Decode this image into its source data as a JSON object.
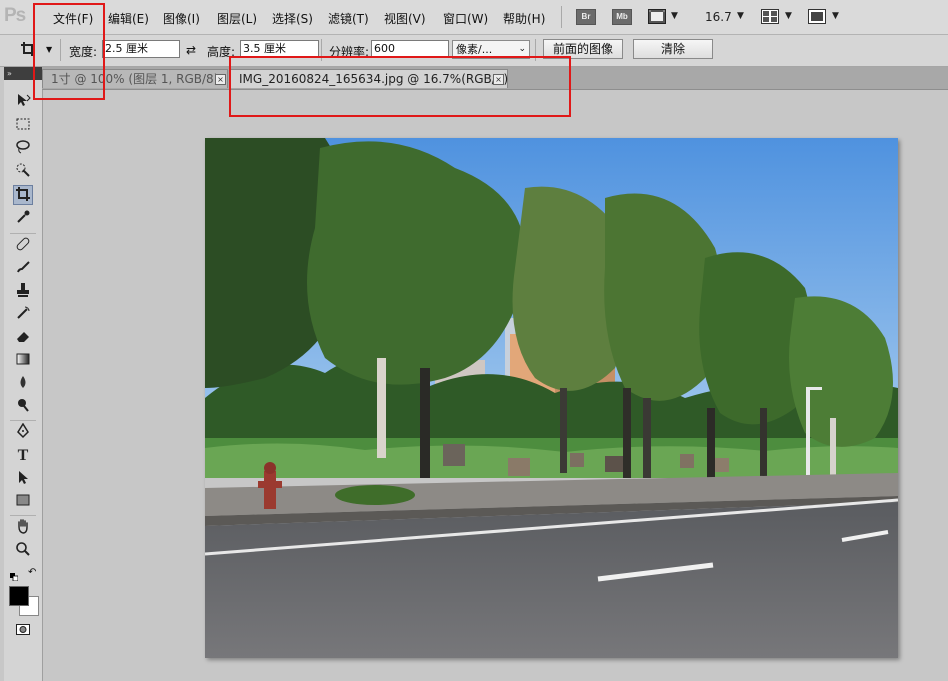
{
  "app": {
    "logo": "Ps"
  },
  "menu": [
    {
      "id": "file",
      "label": "文件(F)"
    },
    {
      "id": "edit",
      "label": "编辑(E)"
    },
    {
      "id": "image",
      "label": "图像(I)"
    },
    {
      "id": "layer",
      "label": "图层(L)"
    },
    {
      "id": "select",
      "label": "选择(S)"
    },
    {
      "id": "filter",
      "label": "滤镜(T)"
    },
    {
      "id": "view",
      "label": "视图(V)"
    },
    {
      "id": "window",
      "label": "窗口(W)"
    },
    {
      "id": "help",
      "label": "帮助(H)"
    }
  ],
  "appbar": {
    "bridge": "Br",
    "minibridge": "Mb",
    "zoom": "16.7"
  },
  "options": {
    "width_label": "宽度:",
    "width_value": "2.5 厘米",
    "height_label": "高度:",
    "height_value": "3.5 厘米",
    "resolution_label": "分辨率:",
    "resolution_value": "600",
    "unit_select": "像素/...",
    "front_image_button": "前面的图像",
    "clear_button": "清除"
  },
  "tabs": [
    {
      "label": "1寸 @ 100% (图层 1, RGB/8)",
      "close": "×",
      "active": false
    },
    {
      "label": "IMG_20160824_165634.jpg @ 16.7%(RGB/8)",
      "close": "×",
      "active": true
    }
  ],
  "tools_panel": {
    "collapse": "»"
  },
  "colors": {
    "highlight": "#e01818",
    "tool_active": "#a9b7cc"
  }
}
